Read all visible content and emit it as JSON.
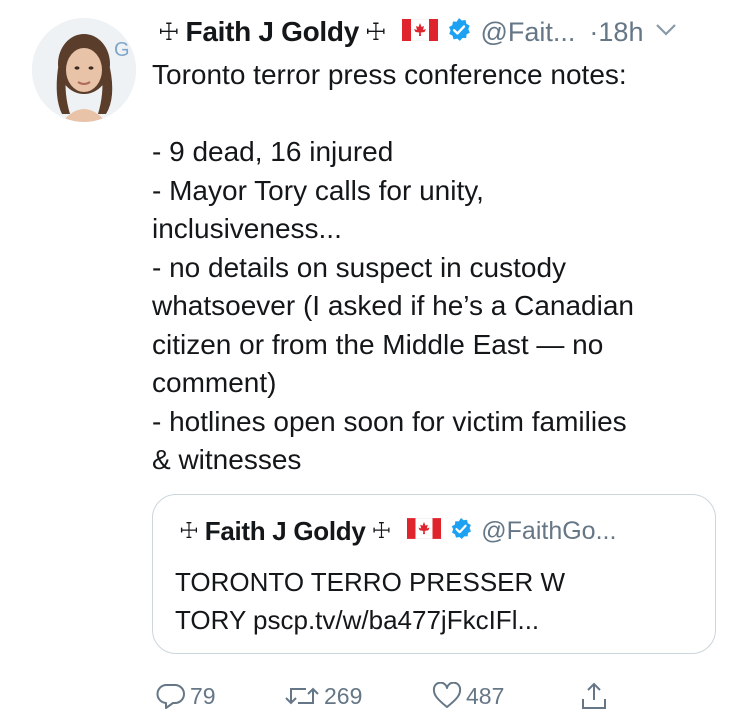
{
  "tweet": {
    "display_name": "Faith J Goldy",
    "cross_left": "☩",
    "cross_right": "☩",
    "handle": "@Fait...",
    "time_sep": "·",
    "time": "18h",
    "text": "Toronto terror press conference notes:\n\n- 9 dead, 16 injured\n- Mayor Tory calls for unity,\ninclusiveness...\n- no details on suspect in custody\nwhatsoever (I asked if he’s a Canadian\ncitizen or from the Middle East — no\ncomment)\n- hotlines open soon for victim families\n& witnesses",
    "icons": {
      "avatar": "profile-photo",
      "flag": "canada-flag-icon",
      "verified": "verified-badge-icon",
      "menu": "chevron-down-icon"
    }
  },
  "quoted_tweet": {
    "display_name": "Faith J Goldy",
    "cross_left": "☩",
    "cross_right": "☩",
    "handle": "@FaithGo...",
    "text": "TORONTO TERRO PRESSER W\nTORY pscp.tv/w/ba477jFkcIFl..."
  },
  "actions": {
    "reply_count": "79",
    "retweet_count": "269",
    "like_count": "487",
    "icons": [
      "reply-icon",
      "retweet-icon",
      "like-icon",
      "share-icon"
    ]
  },
  "colors": {
    "text": "#14171a",
    "secondary": "#657786",
    "verified_blue": "#1da1f2",
    "flag_red": "#e0242e",
    "border": "#ccd6dd"
  }
}
